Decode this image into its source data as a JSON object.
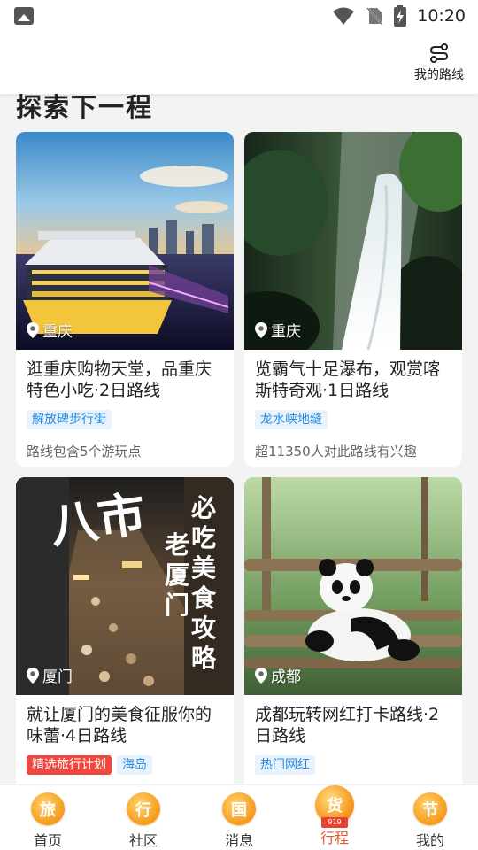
{
  "status_bar": {
    "time": "10:20"
  },
  "header": {
    "route_label": "我的路线"
  },
  "section": {
    "title": "探索下一程"
  },
  "cards": [
    {
      "location": "重庆",
      "title": "逛重庆购物天堂，品重庆特色小吃·2日路线",
      "tags": [
        {
          "text": "解放碑步行街",
          "style": "blue"
        }
      ],
      "desc": "路线包含5个游玩点"
    },
    {
      "location": "重庆",
      "title": "览霸气十足瀑布，观赏喀斯特奇观·1日路线",
      "tags": [
        {
          "text": "龙水峡地缝",
          "style": "blue"
        }
      ],
      "desc": "超11350人对此路线有兴趣"
    },
    {
      "location": "厦门",
      "title": "就让厦门的美食征服你的味蕾·4日路线",
      "tags": [
        {
          "text": "精选旅行计划",
          "style": "red"
        },
        {
          "text": "海岛",
          "style": "blue"
        }
      ],
      "desc": ""
    },
    {
      "location": "成都",
      "title": "成都玩转网红打卡路线·2日路线",
      "tags": [
        {
          "text": "热门网红",
          "style": "blue"
        }
      ],
      "desc": ""
    }
  ],
  "card3_image_text": {
    "big": "八市",
    "right": "必吃美食攻略",
    "left": "老厦门"
  },
  "tabs": [
    {
      "icon_char": "旅",
      "label": "首页"
    },
    {
      "icon_char": "行",
      "label": "社区"
    },
    {
      "icon_char": "国",
      "label": "消息"
    },
    {
      "icon_char": "货",
      "label": "行程",
      "ribbon": "919"
    },
    {
      "icon_char": "节",
      "label": "我的"
    }
  ],
  "colors": {
    "tag_blue": "#2a8de0",
    "tag_red": "#f0483e",
    "active_tab": "#e8572b",
    "badge_orange": "#f59a1d"
  }
}
